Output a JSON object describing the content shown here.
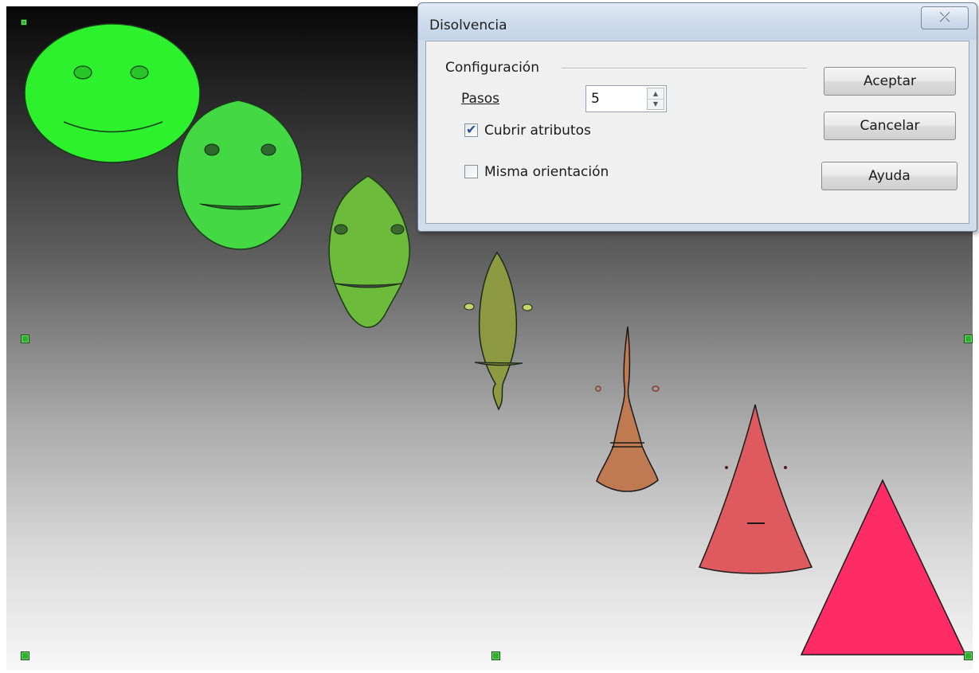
{
  "dialog": {
    "title": "Disolvencia",
    "close_glyph": "⤫",
    "group_title": "Configuración",
    "steps_label": "Pasos",
    "steps_value": "5",
    "cover_attributes": {
      "label": "Cubrir atributos",
      "checked": true
    },
    "same_orientation": {
      "label": "Misma orientación",
      "checked": false
    },
    "buttons": {
      "ok": "Aceptar",
      "cancel": "Cancelar",
      "help": "Ayuda"
    }
  },
  "canvas": {
    "background": "black-to-white vertical gradient",
    "morph_shapes": [
      {
        "name": "ellipse-face",
        "color": "#2cf12c"
      },
      {
        "name": "intermediate-face-1",
        "color": "#44d944"
      },
      {
        "name": "intermediate-face-2",
        "color": "#6cbb3a"
      },
      {
        "name": "intermediate-face-3",
        "color": "#8d9a42"
      },
      {
        "name": "intermediate-face-4",
        "color": "#c07a52"
      },
      {
        "name": "intermediate-face-5",
        "color": "#de5a5e"
      },
      {
        "name": "triangle",
        "color": "#ff2b64"
      }
    ],
    "selection_handle_color": "#2fae2f"
  }
}
